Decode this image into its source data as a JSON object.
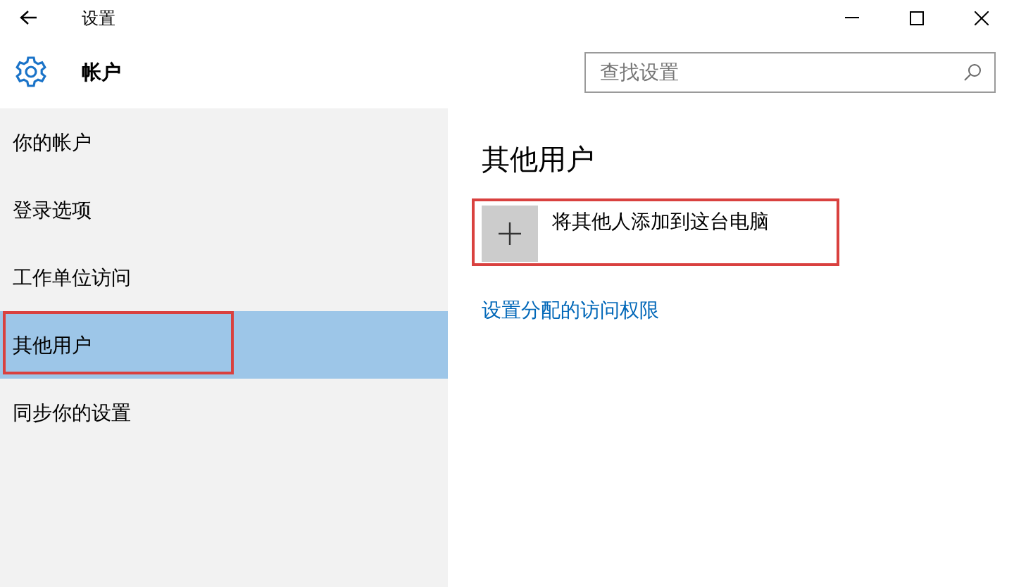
{
  "window": {
    "title": "设置"
  },
  "header": {
    "title": "帐户",
    "search": {
      "placeholder": "查找设置"
    }
  },
  "sidebar": {
    "items": [
      {
        "label": "你的帐户",
        "selected": false,
        "highlighted": false
      },
      {
        "label": "登录选项",
        "selected": false,
        "highlighted": false
      },
      {
        "label": "工作单位访问",
        "selected": false,
        "highlighted": false
      },
      {
        "label": "其他用户",
        "selected": true,
        "highlighted": true
      },
      {
        "label": "同步你的设置",
        "selected": false,
        "highlighted": false
      }
    ]
  },
  "content": {
    "title": "其他用户",
    "add_button": {
      "label": "将其他人添加到这台电脑",
      "highlighted": true
    },
    "link": "设置分配的访问权限"
  }
}
